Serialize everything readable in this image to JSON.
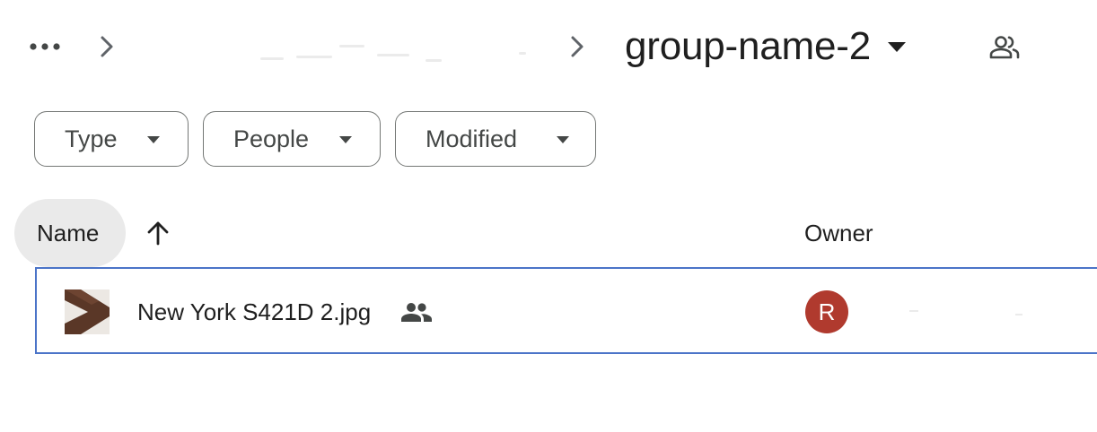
{
  "breadcrumb": {
    "more_icon": "more-horiz-icon",
    "separator_icon": "chevron-right-icon",
    "current_folder": "group-name-2",
    "folder_menu_icon": "arrow-drop-down-icon",
    "shared_icon": "people-outline-icon"
  },
  "filters": {
    "type_label": "Type",
    "people_label": "People",
    "modified_label": "Modified",
    "caret_icon": "arrow-drop-down-icon"
  },
  "columns": {
    "name_label": "Name",
    "sort_icon": "arrow-upward-icon",
    "owner_label": "Owner"
  },
  "files": [
    {
      "name": "New York S421D 2.jpg",
      "thumbnail_icon": "image-thumbnail",
      "shared_icon": "people-icon",
      "owner_initial": "R",
      "owner_avatar_color": "#b03a2e"
    }
  ],
  "colors": {
    "selection_border": "#4b74c8",
    "header_pill_bg": "#eaeaea",
    "chip_border": "#747775"
  }
}
